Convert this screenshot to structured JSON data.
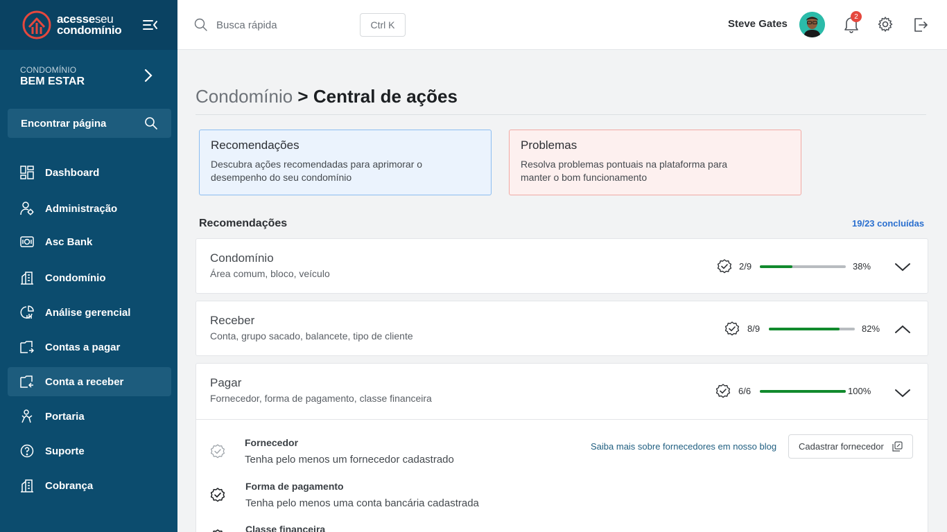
{
  "brand": {
    "line1": "acesse",
    "line1b": "seu",
    "line2": "condomínio",
    "accent": "#e5483e"
  },
  "sidebar": {
    "condo_label": "CONDOMÍNIO",
    "condo_name": "BEM ESTAR",
    "find_label": "Encontrar página",
    "items": [
      {
        "label": "Dashboard",
        "icon": "dashboard-icon"
      },
      {
        "label": "Administração",
        "icon": "admin-icon"
      },
      {
        "label": "Asc Bank",
        "icon": "bank-icon"
      },
      {
        "label": "Condomínio",
        "icon": "building-icon"
      },
      {
        "label": "Análise gerencial",
        "icon": "analytics-icon"
      },
      {
        "label": "Contas a pagar",
        "icon": "payables-icon"
      },
      {
        "label": "Conta a receber",
        "icon": "receivables-icon",
        "active": true
      },
      {
        "label": "Portaria",
        "icon": "gate-icon"
      },
      {
        "label": "Suporte",
        "icon": "help-icon"
      },
      {
        "label": "Cobrança",
        "icon": "billing-icon"
      }
    ]
  },
  "topbar": {
    "search_placeholder": "Busca rápida",
    "shortcut": "Ctrl K",
    "user_name": "Steve Gates",
    "notifications": "2"
  },
  "page": {
    "crumb": "Condomínio",
    "separator": " > ",
    "title": "Central de ações"
  },
  "cards": [
    {
      "title": "Recomendações",
      "desc": "Descubra ações recomendadas para aprimorar o desempenho do seu condomínio"
    },
    {
      "title": "Problemas",
      "desc": "Resolva problemas pontuais na plataforma para manter o bom funcionamento"
    }
  ],
  "recommendations": {
    "title": "Recomendações",
    "count": "19/23 concluídas",
    "groups": [
      {
        "title": "Condomínio",
        "sub": "Área comum, bloco, veículo",
        "fraction": "2/9",
        "percent_label": "38%",
        "progress": 0.38,
        "expanded": false
      },
      {
        "title": "Receber",
        "sub": "Conta, grupo sacado, balancete, tipo de cliente",
        "fraction": "8/9",
        "percent_label": "82%",
        "progress": 0.82,
        "expanded": true
      },
      {
        "title": "Pagar",
        "sub": "Fornecedor, forma de pagamento, classe financeira",
        "fraction": "6/6",
        "percent_label": "100%",
        "progress": 1.0,
        "expanded": false
      }
    ],
    "tasks": [
      {
        "title": "Fornecedor",
        "desc": "Tenha pelo menos um fornecedor cadastrado",
        "link": "Saiba mais sobre fornecedores em nosso blog",
        "button": "Cadastrar fornecedor",
        "done": false
      },
      {
        "title": "Forma de pagamento",
        "desc": "Tenha pelo menos uma conta bancária cadastrada",
        "done": true
      },
      {
        "title": "Classe financeira",
        "desc": "",
        "done": true
      }
    ]
  },
  "colors": {
    "sidebar": "#0c4c6e",
    "progress": "#118a2d",
    "link": "#2a6fcf"
  }
}
